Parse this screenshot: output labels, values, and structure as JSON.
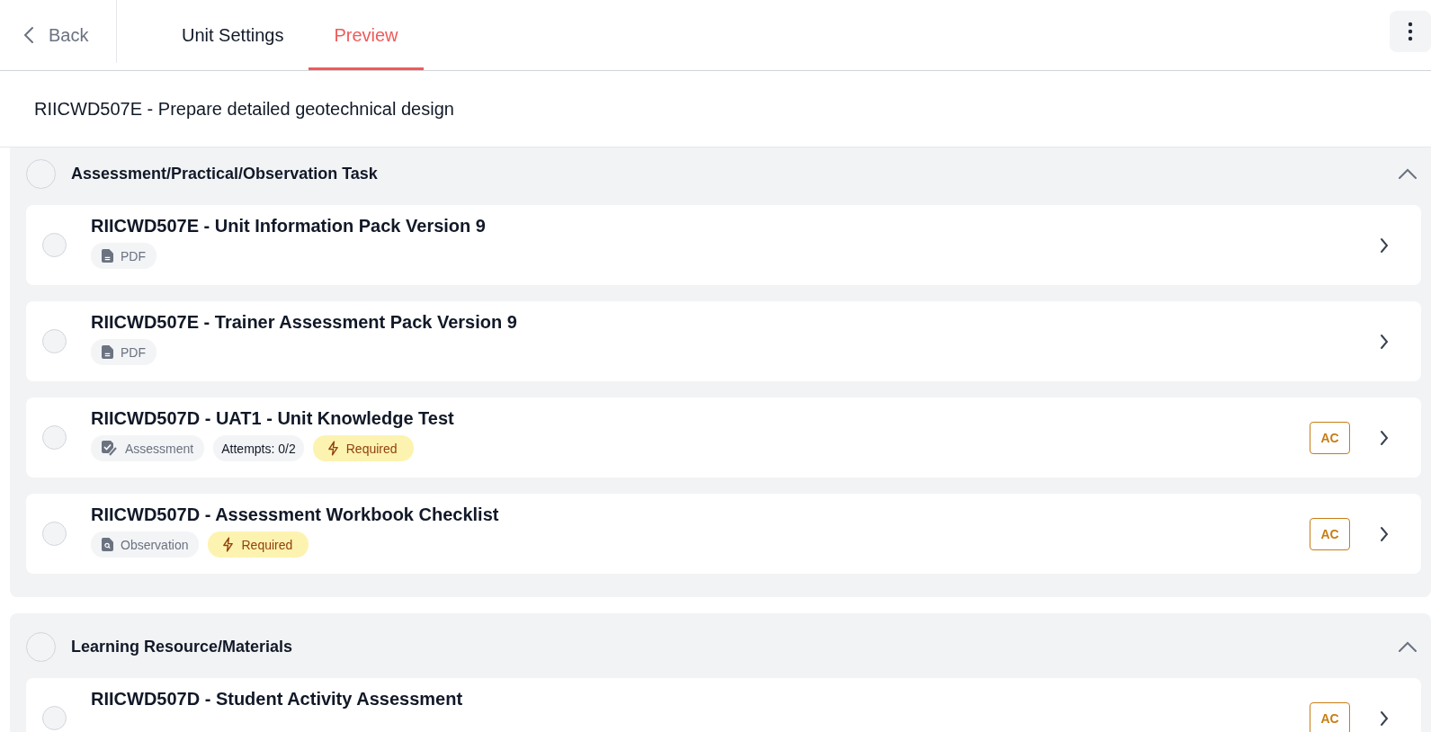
{
  "header": {
    "back": "Back",
    "tabs": [
      {
        "label": "Unit Settings",
        "selected": false
      },
      {
        "label": "Preview",
        "selected": true
      }
    ]
  },
  "unit_title": "RIICWD507E - Prepare detailed geotechnical design",
  "sections": [
    {
      "title": "Assessment/Practical/Observation Task",
      "expanded": true,
      "items": [
        {
          "title": "RIICWD507E - Unit Information Pack Version 9",
          "tags": [
            {
              "kind": "pdf",
              "label": "PDF"
            }
          ]
        },
        {
          "title": "RIICWD507E - Trainer Assessment Pack Version 9",
          "tags": [
            {
              "kind": "pdf",
              "label": "PDF"
            }
          ]
        },
        {
          "title": "RIICWD507D - UAT1 - Unit Knowledge Test",
          "badge": "AC",
          "tags": [
            {
              "kind": "assessment",
              "label": "Assessment"
            },
            {
              "kind": "attempts",
              "label": "Attempts:  0/2"
            },
            {
              "kind": "required",
              "label": "Required"
            }
          ]
        },
        {
          "title": "RIICWD507D - Assessment Workbook Checklist",
          "badge": "AC",
          "tags": [
            {
              "kind": "observation",
              "label": "Observation"
            },
            {
              "kind": "required",
              "label": "Required"
            }
          ]
        }
      ]
    },
    {
      "title": "Learning Resource/Materials",
      "expanded": true,
      "items": [
        {
          "title": "RIICWD507D - Student Activity Assessment",
          "badge": "AC"
        }
      ]
    }
  ]
}
